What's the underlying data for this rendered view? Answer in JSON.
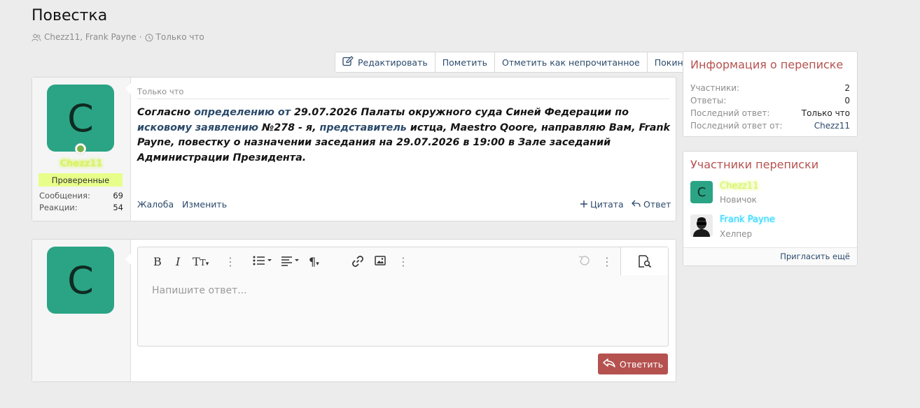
{
  "page": {
    "title": "Повестка",
    "participants_text": "Chezz11, Frank Payne",
    "separator": "·",
    "time_text": "Только что"
  },
  "actions": {
    "edit": "Редактировать",
    "mark": "Пометить",
    "mark_unread": "Отметить как непрочитанное",
    "leave": "Покинуть"
  },
  "post": {
    "avatar_letter": "C",
    "author": "Chezz11",
    "badge": "Проверенные",
    "stats": [
      {
        "label": "Сообщения:",
        "value": "69"
      },
      {
        "label": "Реакции:",
        "value": "54"
      }
    ],
    "time": "Только что",
    "body": {
      "p1": "Согласно ",
      "l1": "определению от",
      "p2": " 29.07.2026 Палаты окружного суда Синей Федерации по ",
      "l2": "исковому заявлению",
      "p3": " №278 - я, ",
      "l3": "представитель",
      "p4": " истца, Maestro Qoore, направляю Вам, Frank Payne, повестку о назначении заседания на 29.07.2026 в 19:00 в Зале заседаний Администрации Президента."
    },
    "report": "Жалоба",
    "edit": "Изменить",
    "quote": "Цитата",
    "reply": "Ответ"
  },
  "reply_form": {
    "avatar_letter": "C",
    "placeholder": "Напишите ответ...",
    "submit": "Ответить",
    "toolbar_icons": [
      "bold-icon",
      "italic-icon",
      "text-size-icon",
      "more-icon",
      "list-icon",
      "align-icon",
      "paragraph-icon",
      "link-icon",
      "image-icon",
      "more-icon",
      "undo-icon",
      "more-icon",
      "preview-icon"
    ]
  },
  "info": {
    "heading": "Информация о переписке",
    "rows": [
      {
        "label": "Участники:",
        "value": "2"
      },
      {
        "label": "Ответы:",
        "value": "0"
      },
      {
        "label": "Последний ответ:",
        "value": "Только что"
      },
      {
        "label": "Последний ответ от:",
        "value": "Chezz11"
      }
    ]
  },
  "members": {
    "heading": "Участники переписки",
    "list": [
      {
        "avatar_letter": "C",
        "name": "Chezz11",
        "role": "Новичок"
      },
      {
        "avatar_letter": "",
        "name": "Frank Payne",
        "role": "Хелпер"
      }
    ],
    "invite": "Пригласить ещё"
  },
  "colors": {
    "accent": "#b5524f",
    "link": "#2b4a6b",
    "avatar_green": "#2aa485",
    "badge_bg": "#e7ff8a",
    "name_glow_yellow": "#d8f26a",
    "name_glow_cyan": "#30d5ff"
  }
}
